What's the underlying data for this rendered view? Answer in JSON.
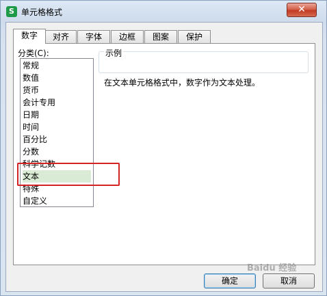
{
  "window": {
    "title": "单元格格式",
    "app_icon_letter": "S",
    "close_glyph": "✕"
  },
  "tabs": [
    {
      "label": "数字",
      "active": true
    },
    {
      "label": "对齐"
    },
    {
      "label": "字体"
    },
    {
      "label": "边框"
    },
    {
      "label": "图案"
    },
    {
      "label": "保护"
    }
  ],
  "category": {
    "label": "分类(C):",
    "items": [
      "常规",
      "数值",
      "货币",
      "会计专用",
      "日期",
      "时间",
      "百分比",
      "分数",
      "科学记数",
      "文本",
      "特殊",
      "自定义"
    ],
    "selected": "文本"
  },
  "sample": {
    "label": "示例"
  },
  "description": "在文本单元格格式中，数字作为文本处理。",
  "buttons": {
    "ok": "确定",
    "cancel": "取消"
  },
  "watermark": "Baidu 经验",
  "colors": {
    "selection": "#d9ebd4",
    "highlight": "#d42121",
    "close": "#c23a23"
  }
}
